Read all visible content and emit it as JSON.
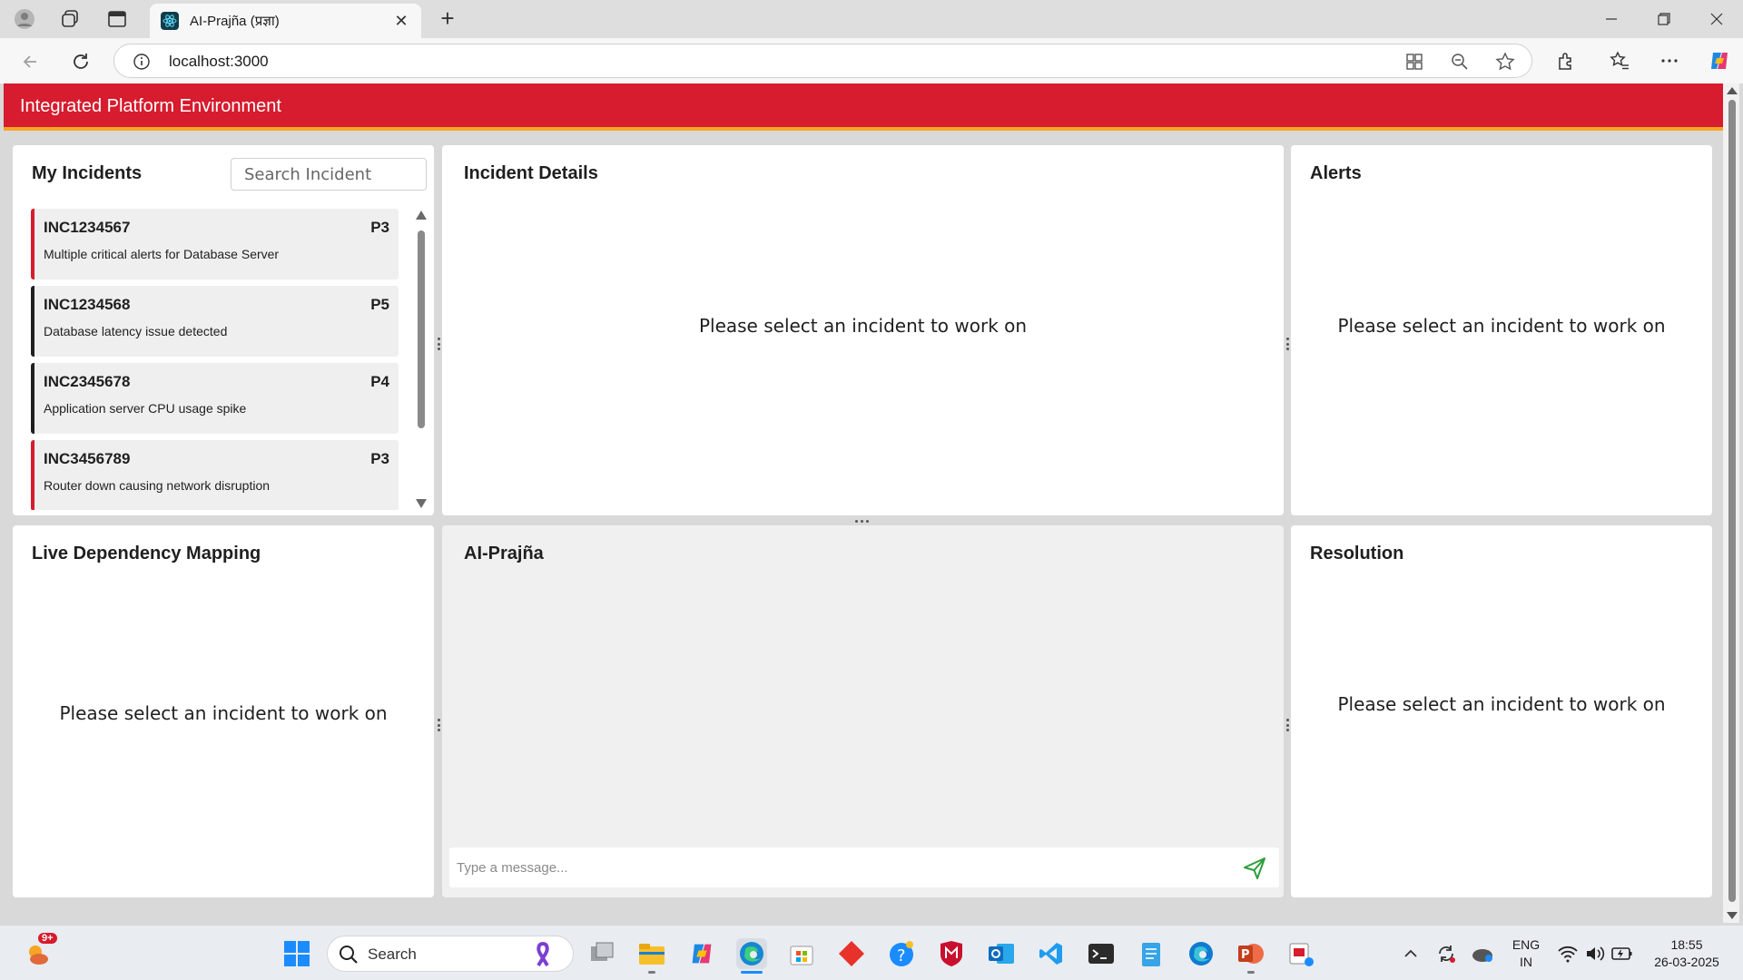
{
  "browser": {
    "tab_title": "AI-Prajña (प्रज्ञा)",
    "tab_close": "✕",
    "new_tab": "+",
    "url": "localhost:3000"
  },
  "app": {
    "header_title": "Integrated Platform Environment",
    "colors": {
      "header": "#d61c2e",
      "header_accent": "#f6a623",
      "critical": "#d61c2e",
      "normal": "#1f1f1f"
    }
  },
  "incidents": {
    "title": "My Incidents",
    "search_placeholder": "Search Incident",
    "items": [
      {
        "id": "INC1234567",
        "priority": "P3",
        "description": "Multiple critical alerts for Database Server",
        "marker": "critical"
      },
      {
        "id": "INC1234568",
        "priority": "P5",
        "description": "Database latency issue detected",
        "marker": "normal"
      },
      {
        "id": "INC2345678",
        "priority": "P4",
        "description": "Application server CPU usage spike",
        "marker": "normal"
      },
      {
        "id": "INC3456789",
        "priority": "P3",
        "description": "Router down causing network disruption",
        "marker": "critical"
      }
    ]
  },
  "panels": {
    "incident_details": {
      "title": "Incident Details",
      "placeholder": "Please select an incident to work on"
    },
    "alerts": {
      "title": "Alerts",
      "placeholder": "Please select an incident to work on"
    },
    "dependency": {
      "title": "Live Dependency Mapping",
      "placeholder": "Please select an incident to work on"
    },
    "chat": {
      "title": "AI-Prajña",
      "input_placeholder": "Type a message..."
    },
    "resolution": {
      "title": "Resolution",
      "placeholder": "Please select an incident to work on"
    }
  },
  "taskbar": {
    "search_label": "Search",
    "weather_badge": "9+",
    "language": "ENG",
    "region": "IN",
    "time": "18:55",
    "date": "26-03-2025"
  }
}
